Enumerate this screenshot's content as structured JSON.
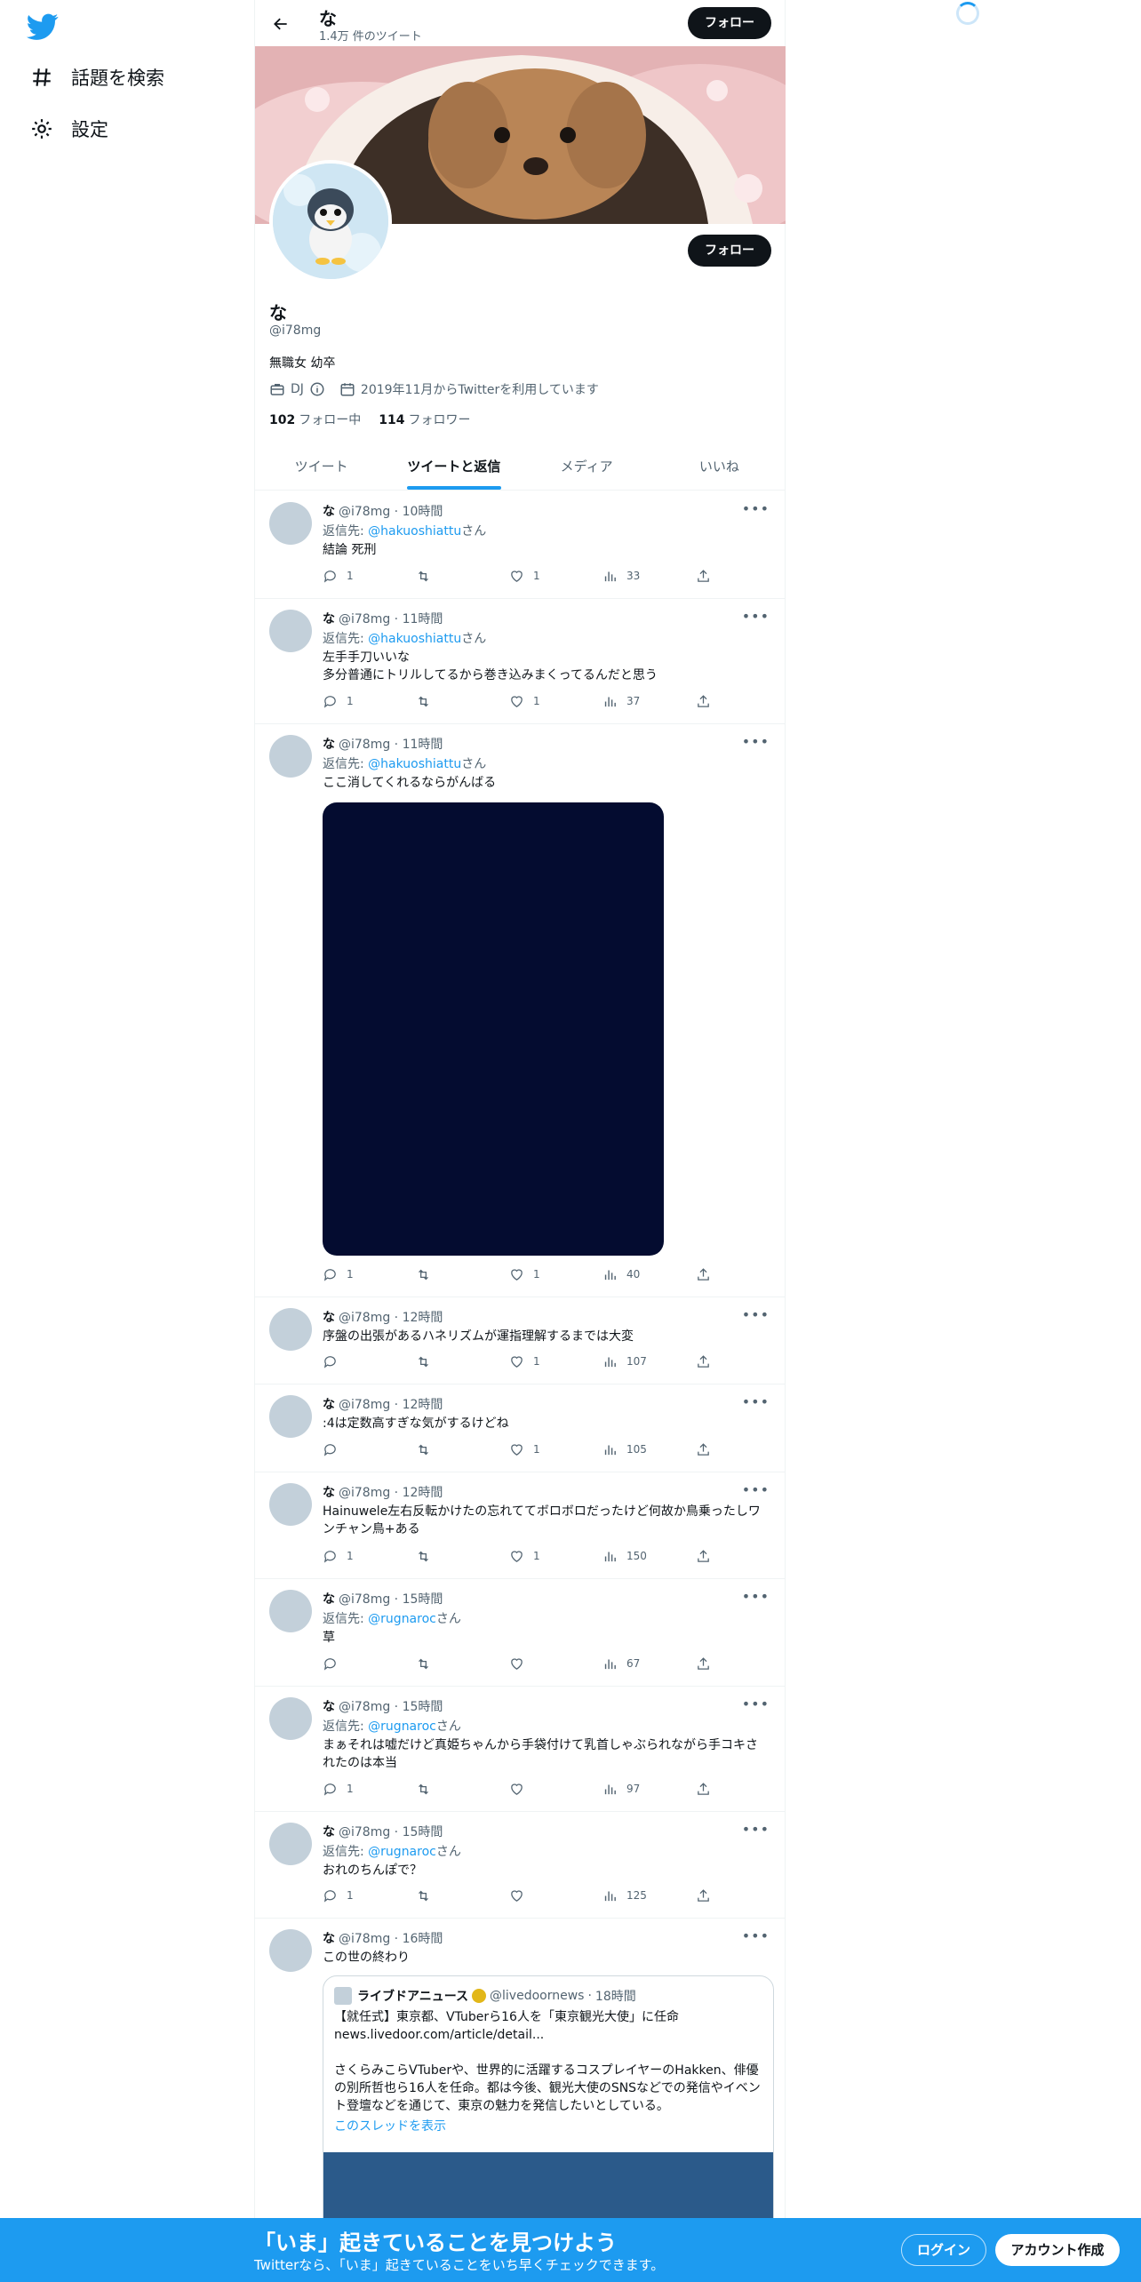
{
  "nav": {
    "explore_label": "話題を検索",
    "settings_label": "設定"
  },
  "header": {
    "name": "な",
    "tweet_count": "1.4万 件のツイート",
    "follow_label": "フォロー"
  },
  "profile": {
    "display_name": "な",
    "handle": "@i78mg",
    "bio": "無職女 幼卒",
    "category": "DJ",
    "joined": "2019年11月からTwitterを利用しています",
    "following_count": "102",
    "following_label": "フォロー中",
    "followers_count": "114",
    "followers_label": "フォロワー",
    "follow_label": "フォロー"
  },
  "tabs": [
    {
      "label": "ツイート"
    },
    {
      "label": "ツイートと返信"
    },
    {
      "label": "メディア"
    },
    {
      "label": "いいね"
    }
  ],
  "reply_prefix": "返信先: ",
  "reply_suffix": "さん",
  "tweets": [
    {
      "name": "な",
      "handle": "@i78mg",
      "time": "10時間",
      "reply_to": "@hakuoshiattu",
      "text": "結論 死刑",
      "replies": "1",
      "retweets": "",
      "likes": "1",
      "views": "33"
    },
    {
      "name": "な",
      "handle": "@i78mg",
      "time": "11時間",
      "reply_to": "@hakuoshiattu",
      "text": "左手手刀いいな\n多分普通にトリルしてるから巻き込みまくってるんだと思う",
      "replies": "1",
      "retweets": "",
      "likes": "1",
      "views": "37"
    },
    {
      "name": "な",
      "handle": "@i78mg",
      "time": "11時間",
      "reply_to": "@hakuoshiattu",
      "text": "ここ消してくれるならがんばる",
      "replies": "1",
      "retweets": "",
      "likes": "1",
      "views": "40"
    },
    {
      "name": "な",
      "handle": "@i78mg",
      "time": "12時間",
      "reply_to": "",
      "text": "序盤の出張があるハネリズムが運指理解するまでは大変",
      "replies": "",
      "retweets": "",
      "likes": "1",
      "views": "107"
    },
    {
      "name": "な",
      "handle": "@i78mg",
      "time": "12時間",
      "reply_to": "",
      "text": ":4は定数高すぎな気がするけどね",
      "replies": "",
      "retweets": "",
      "likes": "1",
      "views": "105"
    },
    {
      "name": "な",
      "handle": "@i78mg",
      "time": "12時間",
      "reply_to": "",
      "text": "Hainuwele左右反転かけたの忘れててボロボロだったけど何故か鳥乗ったしワンチャン鳥+ある",
      "replies": "1",
      "retweets": "",
      "likes": "1",
      "views": "150"
    },
    {
      "name": "な",
      "handle": "@i78mg",
      "time": "15時間",
      "reply_to": "@rugnaroc",
      "text": "草",
      "replies": "",
      "retweets": "",
      "likes": "",
      "views": "67"
    },
    {
      "name": "な",
      "handle": "@i78mg",
      "time": "15時間",
      "reply_to": "@rugnaroc",
      "text": "まぁそれは嘘だけど真姫ちゃんから手袋付けて乳首しゃぶられながら手コキされたのは本当",
      "replies": "1",
      "retweets": "",
      "likes": "",
      "views": "97"
    },
    {
      "name": "な",
      "handle": "@i78mg",
      "time": "15時間",
      "reply_to": "@rugnaroc",
      "text": "おれのちんぽで？",
      "replies": "1",
      "retweets": "",
      "likes": "",
      "views": "125"
    },
    {
      "name": "な",
      "handle": "@i78mg",
      "time": "16時間",
      "reply_to": "",
      "text": "この世の終わり",
      "replies": "",
      "retweets": "",
      "likes": "",
      "views": ""
    }
  ],
  "quote": {
    "name": "ライブドアニュース",
    "handle": "@livedoornews",
    "time": "18時間",
    "text": "【就任式】東京都、VTuberら16人を「東京観光大使」に任命\nnews.livedoor.com/article/detail...\n\nさくらみこらVTuberや、世界的に活躍するコスプレイヤーのHakken、俳優の別所哲也ら16人を任命。都は今後、観光大使のSNSなどでの発信やイベント登壇などを通じて、東京の魅力を発信したいとしている。",
    "thread_label": "このスレッドを表示"
  },
  "bottom_bar": {
    "title": "「いま」起きていることを見つけよう",
    "subtitle": "Twitterなら、「いま」起きていることをいち早くチェックできます。",
    "login_label": "ログイン",
    "signup_label": "アカウント作成"
  },
  "colors": {
    "accent": "#1d9bf0",
    "text": "#0f1419",
    "muted": "#536471"
  }
}
